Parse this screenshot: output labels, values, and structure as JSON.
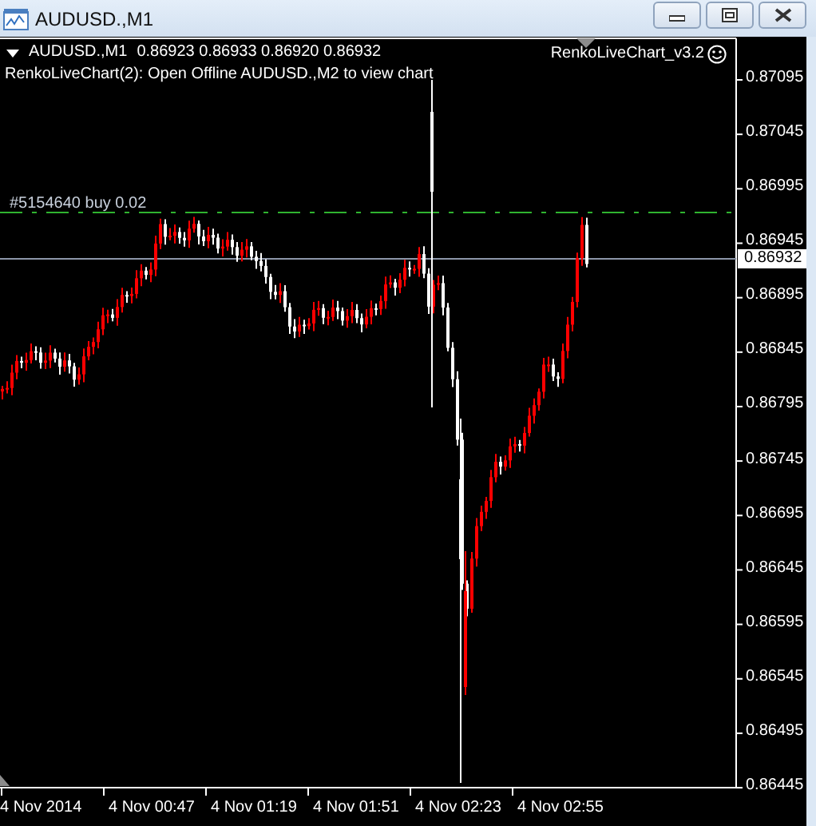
{
  "window": {
    "title": "AUDUSD.,M1"
  },
  "chart": {
    "symbol": "AUDUSD.,M1",
    "ohlc": "0.86923 0.86933 0.86920 0.86932",
    "message": "RenkoLiveChart(2): Open Offline AUDUSD.,M2 to view chart",
    "indicator": "RenkoLiveChart_v3.2",
    "order_label": "#5154640 buy 0.02",
    "current_price": "0.86932",
    "price_labels": [
      "0.87095",
      "0.87045",
      "0.86995",
      "0.86945",
      "0.86895",
      "0.86845",
      "0.86795",
      "0.86745",
      "0.86695",
      "0.86645",
      "0.86595",
      "0.86545",
      "0.86495",
      "0.86445"
    ],
    "time_labels": [
      "4 Nov 2014",
      "4 Nov 00:47",
      "4 Nov 01:19",
      "4 Nov 01:51",
      "4 Nov 02:23",
      "4 Nov 02:55"
    ]
  }
}
